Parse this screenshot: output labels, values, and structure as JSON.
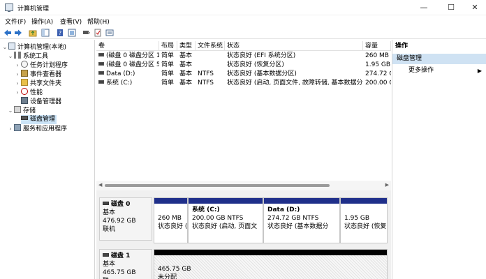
{
  "window": {
    "title": "计算机管理",
    "controls": {
      "minimize": "—",
      "maximize": "☐",
      "close": "✕"
    }
  },
  "menu": [
    "文件(F)",
    "操作(A)",
    "查看(V)",
    "帮助(H)"
  ],
  "toolbar_icons": [
    "back-arrow-icon",
    "forward-arrow-icon",
    "folder-up-icon",
    "show-tree-icon",
    "help-book-icon",
    "properties-icon",
    "connect-icon",
    "check-icon",
    "export-icon"
  ],
  "tree": [
    {
      "label": "计算机管理(本地)",
      "expanded": true,
      "level": 0
    },
    {
      "label": "系统工具",
      "expanded": true,
      "level": 1
    },
    {
      "label": "任务计划程序",
      "expanded": false,
      "level": 2
    },
    {
      "label": "事件查看器",
      "expanded": false,
      "level": 2
    },
    {
      "label": "共享文件夹",
      "expanded": false,
      "level": 2
    },
    {
      "label": "性能",
      "expanded": false,
      "level": 2
    },
    {
      "label": "设备管理器",
      "level": 2
    },
    {
      "label": "存储",
      "expanded": true,
      "level": 1
    },
    {
      "label": "磁盘管理",
      "level": 2,
      "selected": true
    },
    {
      "label": "服务和应用程序",
      "expanded": false,
      "level": 1
    }
  ],
  "columns": [
    "卷",
    "布局",
    "类型",
    "文件系统",
    "状态",
    "容量"
  ],
  "volumes": [
    {
      "volume": "(磁盘 0 磁盘分区 1)",
      "layout": "简单",
      "type": "基本",
      "fs": "",
      "status": "状态良好 (EFI 系统分区)",
      "capacity": "260 MB"
    },
    {
      "volume": "(磁盘 0 磁盘分区 5)",
      "layout": "简单",
      "type": "基本",
      "fs": "",
      "status": "状态良好 (恢复分区)",
      "capacity": "1.95 GB"
    },
    {
      "volume": "Data (D:)",
      "layout": "简单",
      "type": "基本",
      "fs": "NTFS",
      "status": "状态良好 (基本数据分区)",
      "capacity": "274.72 GB"
    },
    {
      "volume": "系统 (C:)",
      "layout": "简单",
      "type": "基本",
      "fs": "NTFS",
      "status": "状态良好 (启动, 页面文件, 故障转储, 基本数据分区)",
      "capacity": "200.00 GB"
    }
  ],
  "disks": [
    {
      "name": "磁盘 0",
      "kind": "基本",
      "size": "476.92 GB",
      "state": "联机",
      "partitions": [
        {
          "title": "",
          "size": "260 MB",
          "status": "状态良好 (",
          "band": "blue"
        },
        {
          "title": "系统 (C:)",
          "size": "200.00 GB NTFS",
          "status": "状态良好 (启动, 页面文",
          "band": "blue"
        },
        {
          "title": "Data (D:)",
          "size": "274.72 GB NTFS",
          "status": "状态良好 (基本数据分",
          "band": "blue"
        },
        {
          "title": "",
          "size": "1.95 GB",
          "status": "状态良好 (恢复",
          "band": "blue"
        }
      ]
    },
    {
      "name": "磁盘 1",
      "kind": "基本",
      "size": "465.75 GB",
      "state": "联",
      "partitions": [
        {
          "title": "",
          "size": "465.75 GB",
          "status": "未分配",
          "band": "black"
        }
      ]
    }
  ],
  "actions": {
    "header": "操作",
    "section": "磁盘管理",
    "more": "更多操作"
  },
  "colors": {
    "selection": "#cce4f7",
    "partition_band": "#1f2f8a",
    "unallocated_band": "#000000"
  }
}
